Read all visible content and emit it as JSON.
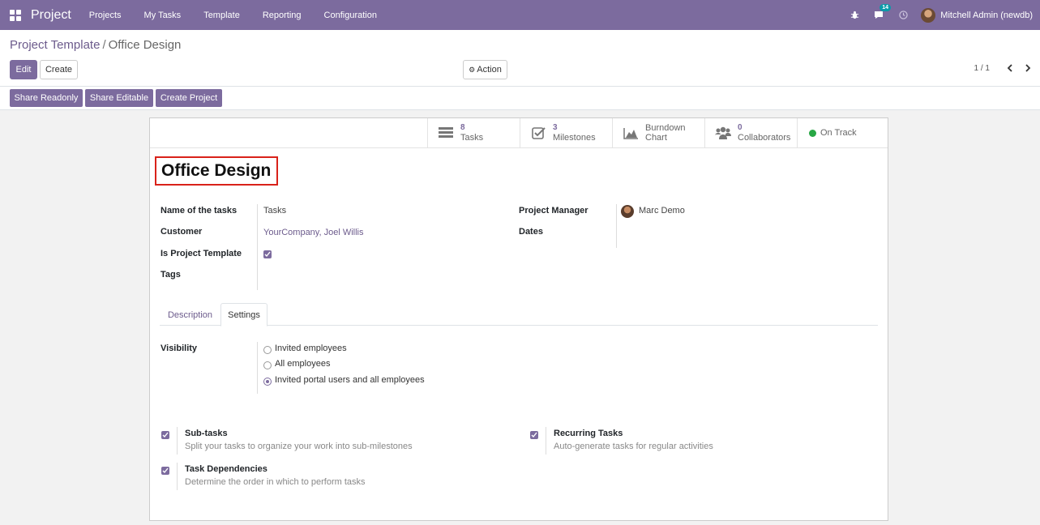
{
  "navbar": {
    "brand": "Project",
    "menu": [
      "Projects",
      "My Tasks",
      "Template",
      "Reporting",
      "Configuration"
    ],
    "chat_count": "14",
    "user": "Mitchell Admin (newdb)"
  },
  "breadcrumb": {
    "parent": "Project Template",
    "separator": "/",
    "current": "Office Design"
  },
  "toolbar": {
    "edit": "Edit",
    "create": "Create",
    "action": "Action",
    "pager": "1 / 1"
  },
  "statusbar": {
    "share_readonly": "Share Readonly",
    "share_editable": "Share Editable",
    "create_project": "Create Project"
  },
  "stats": {
    "tasks": {
      "count": "8",
      "label": "Tasks"
    },
    "milestones": {
      "count": "3",
      "label": "Milestones"
    },
    "burndown": {
      "line1": "Burndown",
      "line2": "Chart"
    },
    "collaborators": {
      "count": "0",
      "label": "Collaborators"
    },
    "status": "On Track"
  },
  "record": {
    "title": "Office Design",
    "fields": {
      "name_of_tasks_label": "Name of the tasks",
      "name_of_tasks_value": "Tasks",
      "customer_label": "Customer",
      "customer_value": "YourCompany, Joel Willis",
      "is_template_label": "Is Project Template",
      "is_template_checked": true,
      "tags_label": "Tags",
      "manager_label": "Project Manager",
      "manager_value": "Marc Demo",
      "dates_label": "Dates"
    }
  },
  "tabs": [
    "Description",
    "Settings"
  ],
  "active_tab": "Settings",
  "settings": {
    "visibility_label": "Visibility",
    "visibility_options": [
      "Invited employees",
      "All employees",
      "Invited portal users and all employees"
    ],
    "visibility_selected": "Invited portal users and all employees",
    "subtasks_title": "Sub-tasks",
    "subtasks_desc": "Split your tasks to organize your work into sub-milestones",
    "recurring_title": "Recurring Tasks",
    "recurring_desc": "Auto-generate tasks for regular activities",
    "dependencies_title": "Task Dependencies",
    "dependencies_desc": "Determine the order in which to perform tasks"
  },
  "colors": {
    "primary": "#7c6b9e",
    "status_green": "#28a745",
    "title_border": "#d9221a"
  }
}
